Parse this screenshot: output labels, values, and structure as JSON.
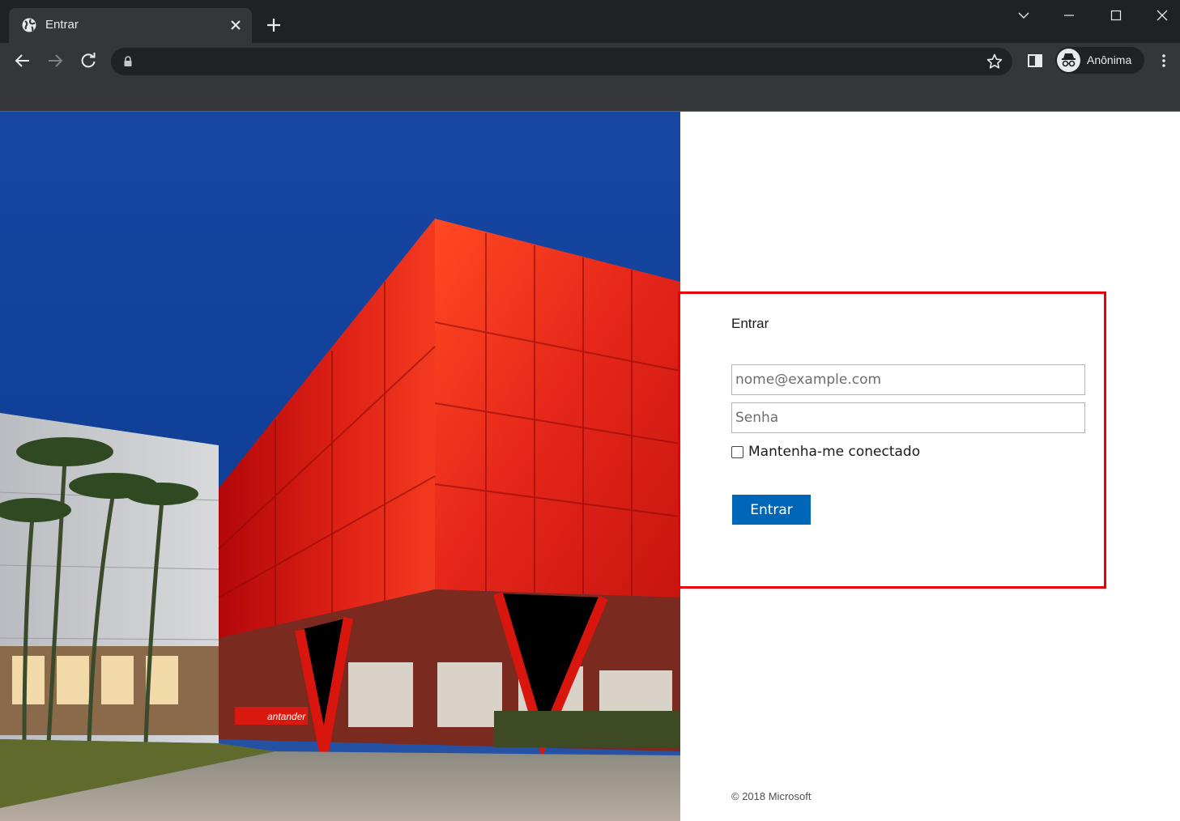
{
  "browser": {
    "tab_title": "Entrar",
    "profile_label": "Anônima",
    "address": ""
  },
  "login": {
    "title": "Entrar",
    "email_placeholder": "nome@example.com",
    "password_placeholder": "Senha",
    "remember_label": "Mantenha-me conectado",
    "remember_checked": false,
    "submit_label": "Entrar"
  },
  "footer": {
    "copyright": "© 2018 Microsoft"
  },
  "illustration": {
    "sign_text": "antander"
  },
  "colors": {
    "primary_button": "#0067b8",
    "highlight_border": "#e8000b",
    "chrome_dark": "#202124",
    "chrome_toolbar": "#35363a"
  }
}
